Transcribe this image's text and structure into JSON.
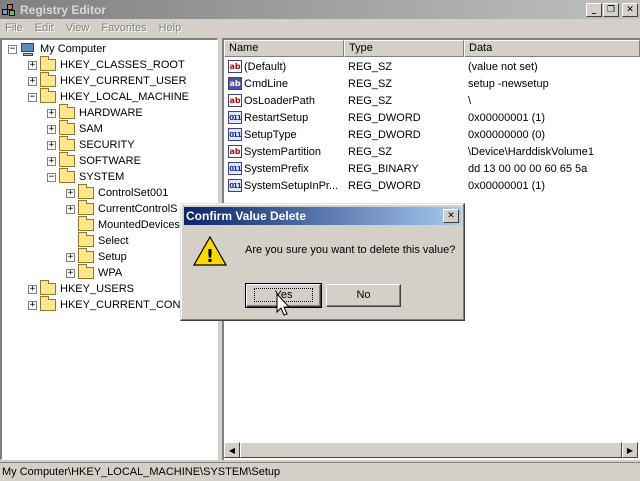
{
  "window": {
    "title": "Registry Editor",
    "minimize_glyph": "_",
    "maximize_glyph": "❐",
    "close_glyph": "✕"
  },
  "menu": [
    "File",
    "Edit",
    "View",
    "Favorites",
    "Help"
  ],
  "tree": {
    "root": "My Computer",
    "nodes": [
      {
        "label": "HKEY_CLASSES_ROOT",
        "expander": "+"
      },
      {
        "label": "HKEY_CURRENT_USER",
        "expander": "+"
      },
      {
        "label": "HKEY_LOCAL_MACHINE",
        "expander": "−"
      },
      {
        "label": "HARDWARE",
        "expander": "+"
      },
      {
        "label": "SAM",
        "expander": "+"
      },
      {
        "label": "SECURITY",
        "expander": "+"
      },
      {
        "label": "SOFTWARE",
        "expander": "+"
      },
      {
        "label": "SYSTEM",
        "expander": "−"
      },
      {
        "label": "ControlSet001",
        "expander": "+"
      },
      {
        "label": "CurrentControlS",
        "expander": "+"
      },
      {
        "label": "MountedDevices",
        "expander": ""
      },
      {
        "label": "Select",
        "expander": ""
      },
      {
        "label": "Setup",
        "expander": "+"
      },
      {
        "label": "WPA",
        "expander": "+"
      },
      {
        "label": "HKEY_USERS",
        "expander": "+"
      },
      {
        "label": "HKEY_CURRENT_CONFI",
        "expander": "+"
      }
    ]
  },
  "list": {
    "columns": [
      "Name",
      "Type",
      "Data"
    ],
    "rows": [
      {
        "name": "(Default)",
        "type": "REG_SZ",
        "data": "(value not set)",
        "icon": "ab"
      },
      {
        "name": "CmdLine",
        "type": "REG_SZ",
        "data": "setup -newsetup",
        "icon": "ab"
      },
      {
        "name": "OsLoaderPath",
        "type": "REG_SZ",
        "data": "\\",
        "icon": "ab"
      },
      {
        "name": "RestartSetup",
        "type": "REG_DWORD",
        "data": "0x00000001 (1)",
        "icon": "011"
      },
      {
        "name": "SetupType",
        "type": "REG_DWORD",
        "data": "0x00000000 (0)",
        "icon": "011"
      },
      {
        "name": "SystemPartition",
        "type": "REG_SZ",
        "data": "\\Device\\HarddiskVolume1",
        "icon": "ab"
      },
      {
        "name": "SystemPrefix",
        "type": "REG_BINARY",
        "data": "dd 13 00 00 00 60 65 5a",
        "icon": "011"
      },
      {
        "name": "SystemSetupInPr...",
        "type": "REG_DWORD",
        "data": "0x00000001 (1)",
        "icon": "011"
      }
    ]
  },
  "status": "My Computer\\HKEY_LOCAL_MACHINE\\SYSTEM\\Setup",
  "dialog": {
    "title": "Confirm Value Delete",
    "close_glyph": "✕",
    "warning_glyph": "!",
    "message": "Are you sure you want to delete this value?",
    "yes_label": "Yes",
    "no_label": "No"
  },
  "scrollbar": {
    "left_arrow": "◀",
    "right_arrow": "▶"
  }
}
